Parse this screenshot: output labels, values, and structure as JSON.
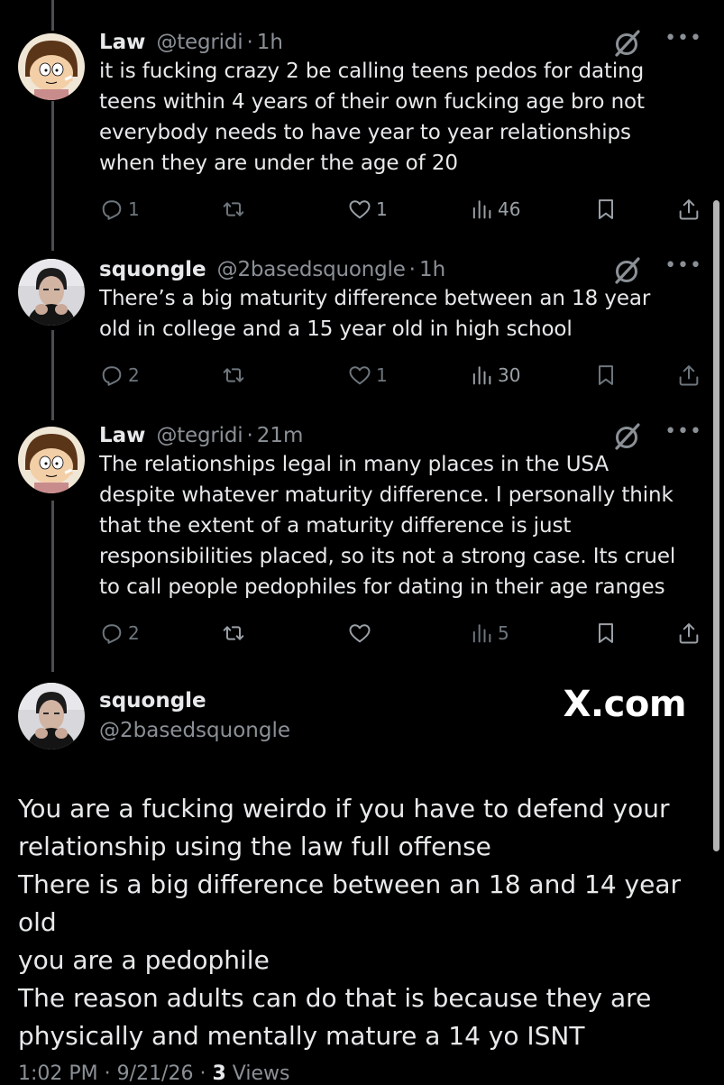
{
  "tweets": [
    {
      "name": "Law",
      "handle": "@tegridi",
      "time": "1h",
      "text": "it is fucking crazy 2 be calling teens pedos for dating\nteens within 4 years of their own fucking age bro not\neverybody needs to have year to year relationships\nwhen they are under the age of 20",
      "replies": "1",
      "reposts": "",
      "likes": "1",
      "views": "46",
      "avatar": "cartoon-avatar"
    },
    {
      "name": "squongle",
      "handle": "@2basedsquongle",
      "time": "1h",
      "text": "There’s a big maturity difference between an 18 year\nold in college and a 15 year old in high school",
      "replies": "2",
      "reposts": "",
      "likes": "1",
      "views": "30",
      "avatar": "photo-avatar"
    },
    {
      "name": "Law",
      "handle": "@tegridi",
      "time": "21m",
      "text": "The relationships legal in many places in the USA\ndespite whatever maturity difference. I personally think\nthat the extent of a maturity difference is just\nresponsibilities placed, so its not a strong case. Its cruel\nto call people pedophiles for dating in their age ranges",
      "replies": "2",
      "reposts": "",
      "likes": "",
      "views": "5",
      "avatar": "cartoon-avatar"
    }
  ],
  "main": {
    "name": "squongle",
    "handle": "@2basedsquongle",
    "watermark": "X.com",
    "text": "You are a fucking weirdo if you have to defend your\nrelationship using the law full offense\nThere is a big difference between an 18 and 14 year old\nyou are a pedophile\nThe reason adults can do that is because they are\nphysically and mentally mature a 14 yo ISNT",
    "time": "1:02 PM",
    "date": "9/21/26",
    "views_count": "3",
    "views_label": "Views"
  },
  "separator": "·",
  "more_label": "•••",
  "icons": [
    "grok-icon",
    "more-icon",
    "reply-icon",
    "repost-icon",
    "like-icon",
    "views-icon",
    "bookmark-icon",
    "share-icon"
  ],
  "colors": {
    "background": "#000000",
    "text": "#e7e9ea",
    "muted": "#8b9096",
    "icon": "#6e767d"
  }
}
